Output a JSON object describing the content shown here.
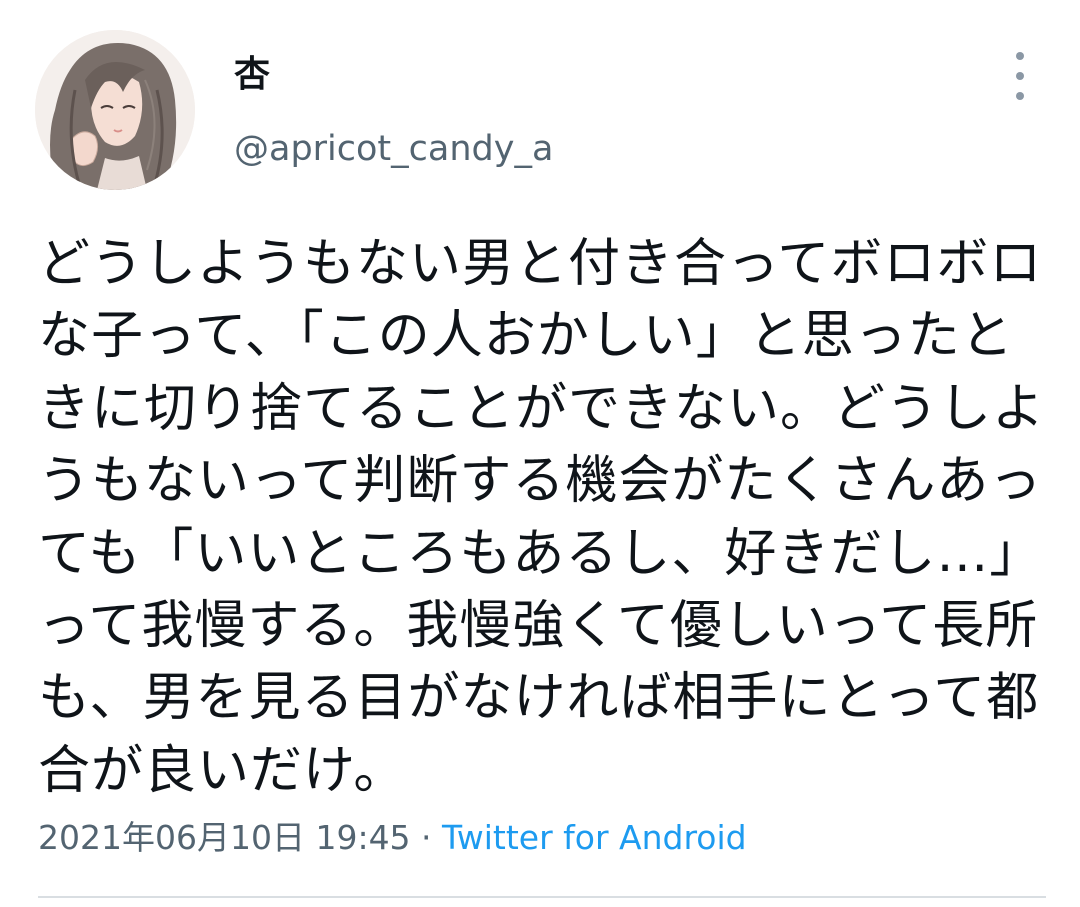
{
  "author": {
    "display_name": "杏",
    "handle": "@apricot_candy_a",
    "avatar_icon": "profile-illustration"
  },
  "tweet": {
    "text": "どうしようもない男と付き合ってボロボロな子って、「この人おかしい」と思ったときに切り捨てることができない。どうしようもないって判断する機会がたくさんあっても「いいところもあるし、好きだし…」って我慢する。我慢強くて優しいって長所も、男を見る目がなければ相手にとって都合が良いだけ。",
    "timestamp": "2021年06月10日 19:45",
    "separator": " · ",
    "source": "Twitter for Android"
  },
  "icons": {
    "more": "more-vertical-icon"
  },
  "colors": {
    "text": "#0f1419",
    "secondary": "#536471",
    "link": "#1d9bf0",
    "divider": "#d9dee2"
  }
}
